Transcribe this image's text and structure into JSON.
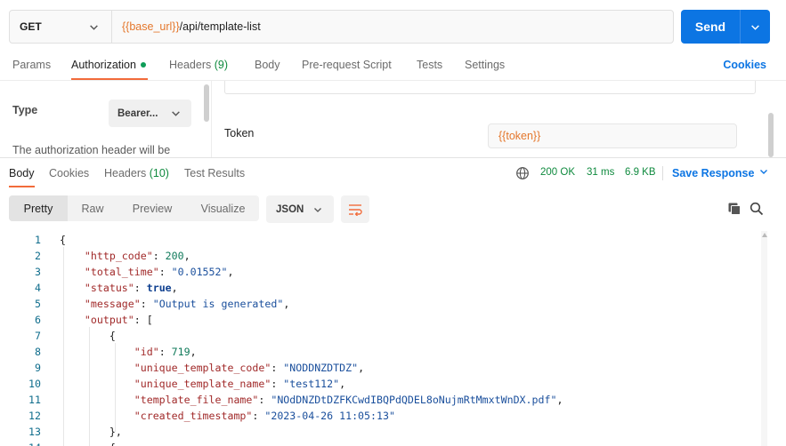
{
  "request": {
    "method": "GET",
    "url_var": "{{base_url}}",
    "url_path": "/api/template-list",
    "send_label": "Send"
  },
  "req_tabs": {
    "params": "Params",
    "authorization": "Authorization",
    "headers": "Headers",
    "headers_count": "(9)",
    "body": "Body",
    "pre_request": "Pre-request Script",
    "tests": "Tests",
    "settings": "Settings",
    "cookies": "Cookies"
  },
  "auth": {
    "type_label": "Type",
    "type_value": "Bearer...",
    "note": "The authorization header will be",
    "token_label": "Token",
    "token_value": "{{token}}"
  },
  "resp_tabs": {
    "body": "Body",
    "cookies": "Cookies",
    "headers": "Headers",
    "headers_count": "(10)",
    "test_results": "Test Results"
  },
  "resp_status": {
    "code": "200 OK",
    "time": "31 ms",
    "size": "6.9 KB",
    "save": "Save Response"
  },
  "view": {
    "pretty": "Pretty",
    "raw": "Raw",
    "preview": "Preview",
    "visualize": "Visualize",
    "format": "JSON"
  },
  "code": {
    "line_numbers": [
      "1",
      "2",
      "3",
      "4",
      "5",
      "6",
      "7",
      "8",
      "9",
      "10",
      "11",
      "12",
      "13",
      "14"
    ],
    "http_code_key": "\"http_code\"",
    "http_code_val": "200",
    "total_time_key": "\"total_time\"",
    "total_time_val": "\"0.01552\"",
    "status_key": "\"status\"",
    "status_val": "true",
    "message_key": "\"message\"",
    "message_val": "\"Output is generated\"",
    "output_key": "\"output\"",
    "id_key": "\"id\"",
    "id_val": "719",
    "utc_key": "\"unique_template_code\"",
    "utc_val": "\"NODDNZDTDZ\"",
    "utn_key": "\"unique_template_name\"",
    "utn_val": "\"test112\"",
    "tfn_key": "\"template_file_name\"",
    "tfn_val": "\"NOdDNZDtDZFKCwdIBQPdQDEL8oNujmRtMmxtWnDX.pdf\"",
    "ct_key": "\"created_timestamp\"",
    "ct_val": "\"2023-04-26 11:05:13\""
  }
}
